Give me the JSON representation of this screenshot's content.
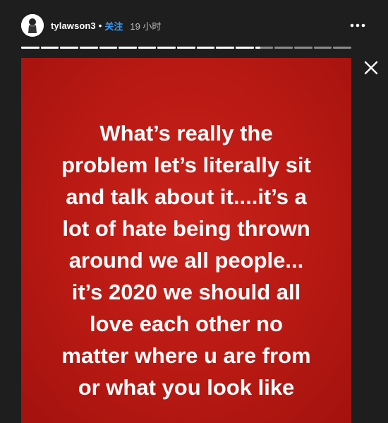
{
  "header": {
    "username": "tylawson3",
    "separator": "•",
    "follow_label": "关注",
    "time": "19 小时"
  },
  "progress": {
    "segments": 17,
    "completed": 12,
    "current_fill": 0.3
  },
  "icons": {
    "more": "more-horizontal-icon",
    "close": "close-icon",
    "avatar": "user-avatar"
  },
  "colors": {
    "background": "#1e1e1e",
    "story_red": "#b81913",
    "follow_blue": "#3897f0"
  },
  "story": {
    "text": "What’s really the\nproblem let’s literally sit\nand talk about it....it’s a\nlot of hate being thrown\naround we all people...\nit’s 2020 we should all\nlove each other no\nmatter where u are from\nor what you look like"
  }
}
